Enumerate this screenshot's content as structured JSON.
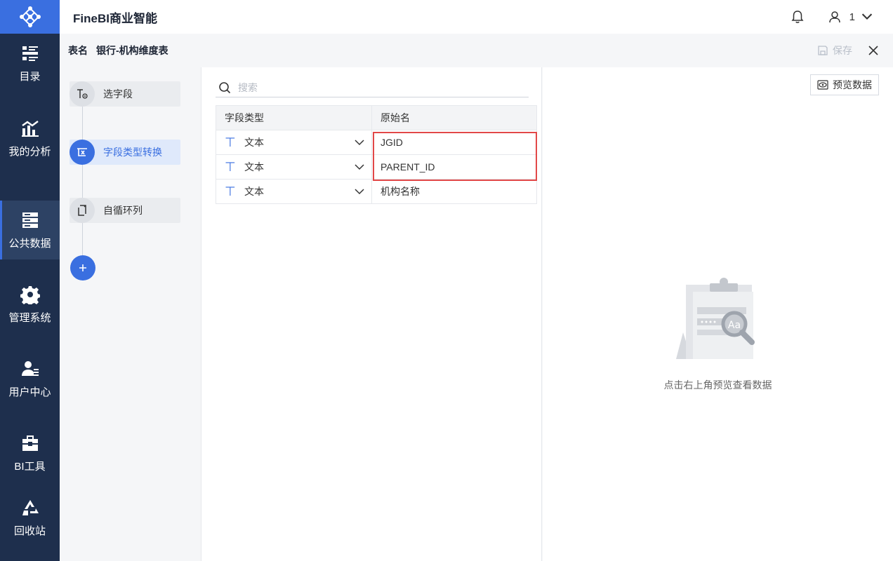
{
  "app": {
    "title": "FineBI商业智能",
    "username": "1"
  },
  "colors": {
    "accent": "#3a6fe0",
    "nav_bg": "#1e2f4d",
    "highlight": "#e24848"
  },
  "nav": {
    "items": [
      {
        "label": "目录",
        "icon": "catalog-icon"
      },
      {
        "label": "我的分析",
        "icon": "analysis-icon"
      },
      {
        "label": "公共数据",
        "icon": "public-data-icon",
        "active": true
      },
      {
        "label": "管理系统",
        "icon": "gear-icon"
      },
      {
        "label": "用户中心",
        "icon": "user-center-icon"
      },
      {
        "label": "BI工具",
        "icon": "toolbox-icon"
      },
      {
        "label": "回收站",
        "icon": "recycle-icon"
      }
    ]
  },
  "header": {
    "table_name_key": "表名",
    "table_name_value": "银行-机构维度表",
    "save_label": "保存"
  },
  "steps": [
    {
      "label": "选字段",
      "icon": "select-field-icon"
    },
    {
      "label": "字段类型转换",
      "icon": "type-convert-icon",
      "active": true
    },
    {
      "label": "自循环列",
      "icon": "self-loop-icon"
    }
  ],
  "search": {
    "placeholder": "搜索"
  },
  "table": {
    "columns": [
      "字段类型",
      "原始名"
    ],
    "rows": [
      {
        "type": "文本",
        "name": "JGID"
      },
      {
        "type": "文本",
        "name": "PARENT_ID"
      },
      {
        "type": "文本",
        "name": "机构名称"
      }
    ]
  },
  "preview": {
    "button_label": "预览数据",
    "empty_text": "点击右上角预览查看数据",
    "illustration_text": "Aa"
  }
}
